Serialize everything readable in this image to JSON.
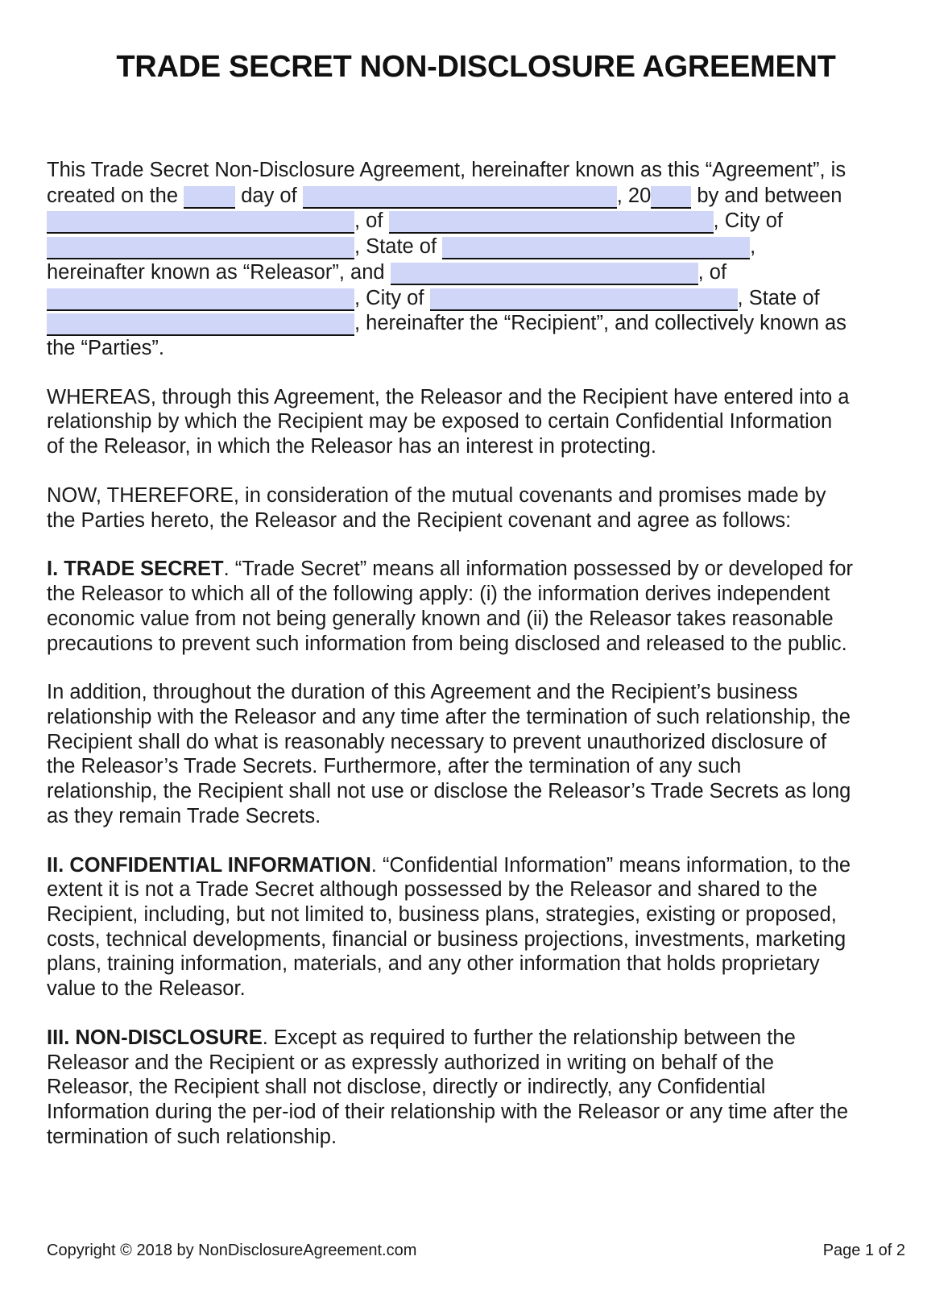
{
  "document": {
    "title": "TRADE SECRET NON-DISCLOSURE AGREEMENT",
    "field_fill_color": "#d0d6f8",
    "text_color": "#1a1a1a",
    "page_background": "#ffffff"
  },
  "intro": {
    "t1": "This Trade Secret Non-Disclosure Agreement, hereinafter known as this “Agreement”, is created on the ",
    "t2": " day of ",
    "t3": ", 20",
    "t4": " by and between ",
    "t5": ", of ",
    "t6": ", City of ",
    "t7": ", State of ",
    "t8": ", hereinafter known as “Releasor”, and ",
    "t9": ", of ",
    "t10": ", City of ",
    "t11": ", State of ",
    "t12": ", hereinafter the “Recipient”, and collectively known as the “Parties”."
  },
  "whereas": {
    "text": "WHEREAS, through this Agreement, the Releasor and the Recipient have entered into a relationship by which the Recipient may be exposed to certain Confidential Information of the Releasor, in which the Releasor has an interest in protecting."
  },
  "now_therefore": {
    "text": "NOW, THEREFORE, in consideration of the mutual covenants and promises made by the Parties hereto, the Releasor and the Recipient covenant and agree as follows:"
  },
  "sections": {
    "one": {
      "heading": "I. TRADE SECRET",
      "body": ". “Trade Secret” means all information possessed by or developed for the Releasor to which all of the following apply: (i) the information derives independent economic value from not being generally known and (ii) the Releasor takes reasonable precautions to prevent such information from being disclosed and released to the public.",
      "continuation": "In addition, throughout the duration of this Agreement and the Recipient’s business relationship with the Releasor and any time after the termination of such relationship, the Recipient shall do what is reasonably necessary to prevent unauthorized disclosure of the Releasor’s Trade Secrets. Furthermore, after the termination of any such relationship, the Recipient shall not use or disclose the Releasor’s Trade Secrets as long as they remain Trade Secrets."
    },
    "two": {
      "heading": "II. CONFIDENTIAL INFORMATION",
      "body": ". “Confidential Information” means information, to the extent it is not a Trade Secret although possessed by the Releasor and shared to the Recipient, including, but not limited to, business plans, strategies, existing or proposed, costs, technical developments, financial or business projections, investments, marketing plans, training information, materials, and any other information that holds proprietary value to the Releasor."
    },
    "three": {
      "heading": "III. NON-DISCLOSURE",
      "body": ". Except as required to further the relationship between the Releasor and the Recipient or as expressly authorized in writing on behalf of the Releasor, the Recipient shall not disclose, directly or indirectly, any Confidential Information during the per-iod of their relationship with the Releasor or any time after the termination of such relationship."
    }
  },
  "footer": {
    "copyright": "Copyright © 2018 by NonDisclosureAgreement.com",
    "page_number": "Page 1 of 2"
  }
}
